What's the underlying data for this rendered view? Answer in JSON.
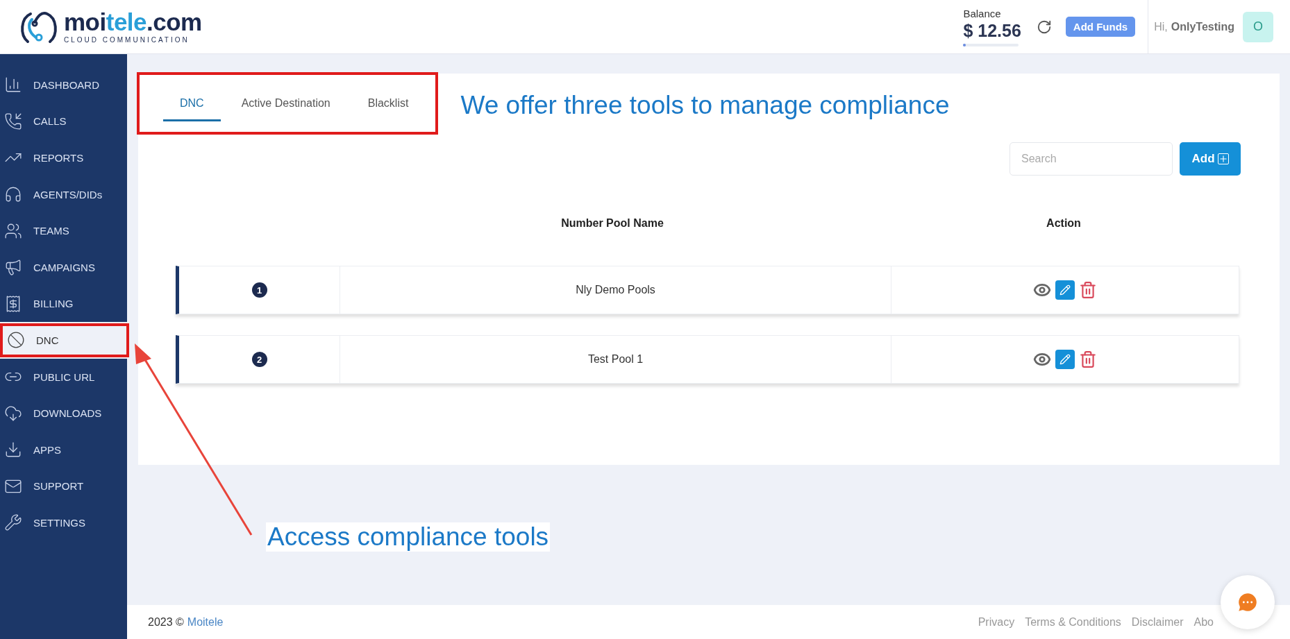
{
  "brand": {
    "name_dark": "moi",
    "name_accent": "tele",
    "name_tail": ".com",
    "tagline": "CLOUD COMMUNICATION"
  },
  "header": {
    "balance_label": "Balance",
    "balance": "$ 12.56",
    "balance_bar": {
      "level": 0.04
    },
    "add_funds": "Add Funds",
    "greeting": "Hi,",
    "user": "OnlyTesting",
    "avatar": "O"
  },
  "sidebar": {
    "items": [
      {
        "label": "DASHBOARD",
        "selected": false
      },
      {
        "label": "CALLS",
        "selected": false
      },
      {
        "label": "REPORTS",
        "selected": false
      },
      {
        "label": "AGENTS/DIDs",
        "selected": false
      },
      {
        "label": "TEAMS",
        "selected": false
      },
      {
        "label": "CAMPAIGNS",
        "selected": false
      },
      {
        "label": "BILLING",
        "selected": false
      },
      {
        "label": "DNC",
        "selected": true
      },
      {
        "label": "PUBLIC URL",
        "selected": false
      },
      {
        "label": "DOWNLOADS",
        "selected": false
      },
      {
        "label": "APPS",
        "selected": false
      },
      {
        "label": "SUPPORT",
        "selected": false
      },
      {
        "label": "SETTINGS",
        "selected": false
      }
    ]
  },
  "tabs": [
    {
      "label": "DNC",
      "selected": true
    },
    {
      "label": "Active Destination",
      "selected": false
    },
    {
      "label": "Blacklist",
      "selected": false
    }
  ],
  "search": {
    "placeholder": "Search"
  },
  "add_button": "Add",
  "table": {
    "columns": [
      "Number Pool Name",
      "Action"
    ],
    "rows": [
      {
        "index": "1",
        "name": "Nly Demo Pools"
      },
      {
        "index": "2",
        "name": "Test Pool 1"
      }
    ]
  },
  "callouts": [
    {
      "text": "We offer three tools to manage compliance"
    },
    {
      "text": "Access compliance tools"
    }
  ],
  "footer": {
    "year": "2023 ©",
    "company": "Moitele",
    "links": [
      "Privacy",
      "Terms & Conditions",
      "Disclaimer",
      "Abo"
    ]
  }
}
